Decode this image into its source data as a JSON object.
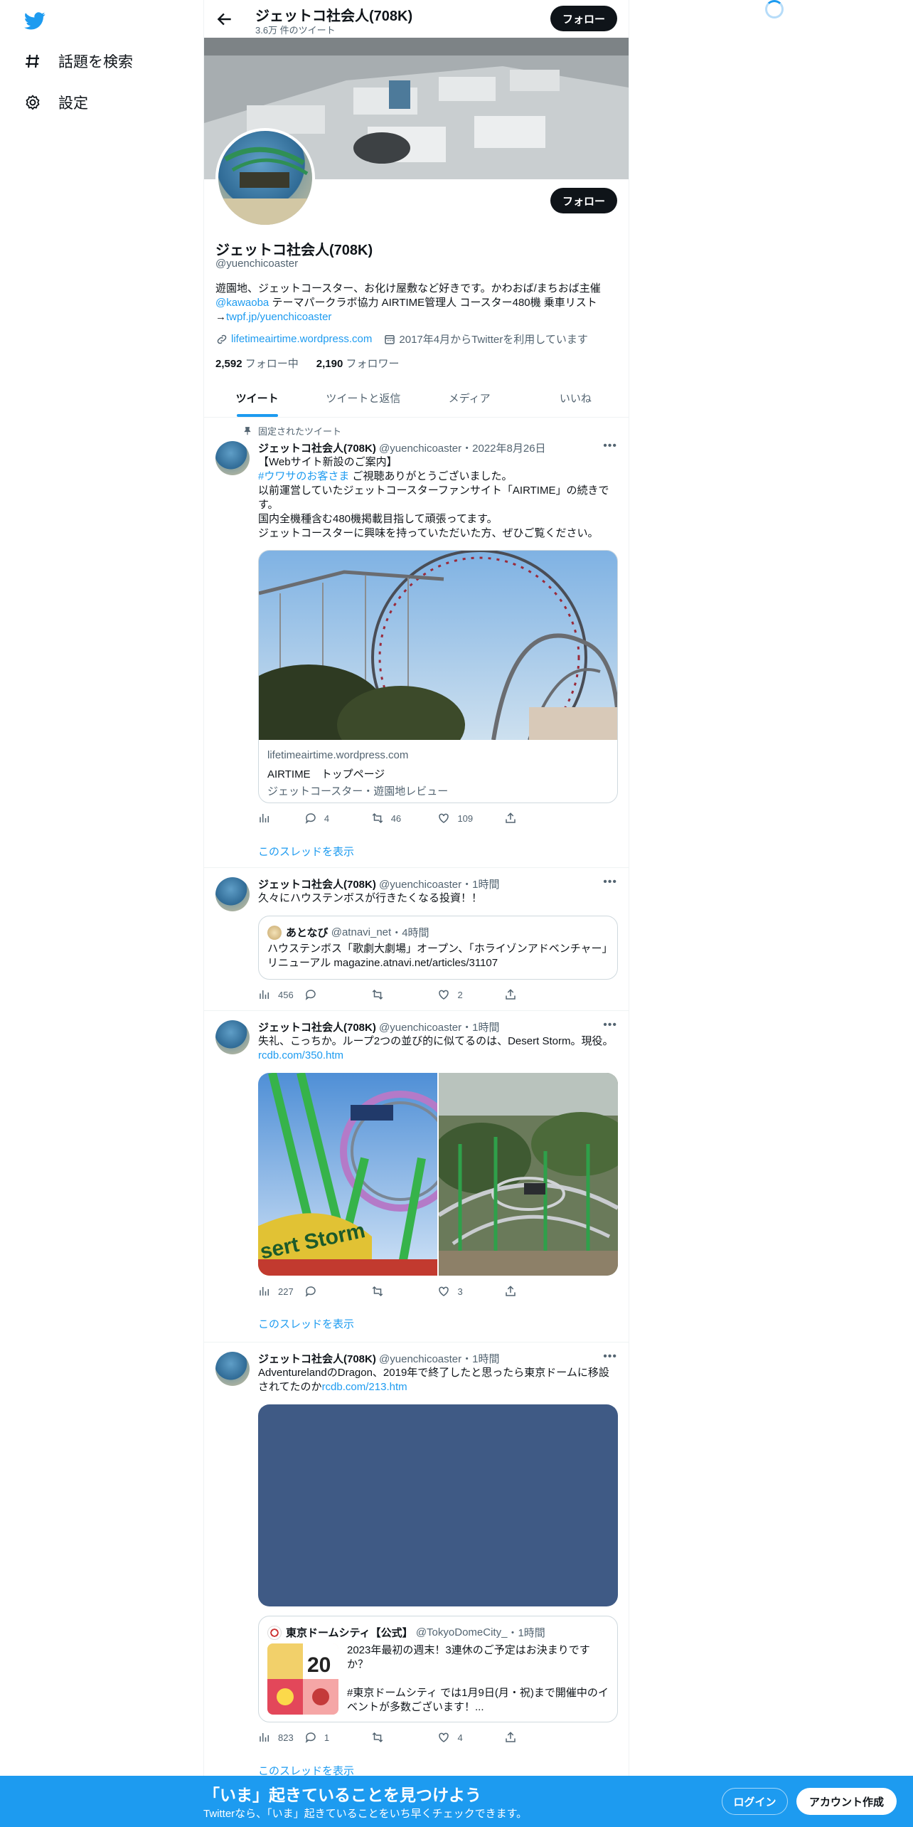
{
  "nav": {
    "explore_label": "話題を検索",
    "settings_label": "設定"
  },
  "header": {
    "name": "ジェットコ社会人(708K)",
    "tweet_count": "3.6万 件のツイート",
    "follow_label": "フォロー"
  },
  "profile": {
    "name": "ジェットコ社会人(708K)",
    "handle": "@yuenchicoaster",
    "follow_label": "フォロー",
    "bio_line1": "遊園地、ジェットコースター、お化け屋敷など好きです。かわおば/まちおば主催",
    "bio_mention": "@kawaoba",
    "bio_line2": " テーマパークラボ協力 AIRTIME管理人 コースター480機 乗車リスト",
    "bio_arrow": "→",
    "bio_link": "twpf.jp/yuenchicoaster",
    "website": "lifetimeairtime.wordpress.com",
    "joined": "2017年4月からTwitterを利用しています",
    "following_count": "2,592",
    "following_label": "フォロー中",
    "followers_count": "2,190",
    "followers_label": "フォロワー"
  },
  "tabs": [
    "ツイート",
    "ツイートと返信",
    "メディア",
    "いいね"
  ],
  "tweets": [
    {
      "pinned_label": "固定されたツイート",
      "name": "ジェットコ社会人(708K)",
      "handle": "@yuenchicoaster",
      "time": "・2022年8月26日",
      "line1": "【Webサイト新設のご案内】",
      "hashtag": "#ウワサのお客さま",
      "line2": " ご視聴ありがとうございました。",
      "line3": "以前運営していたジェットコースターファンサイト「AIRTIME」の続きです。",
      "line4": "国内全機種含む480機掲載目指して頑張ってます。",
      "line5": "ジェットコースターに興味を持っていただいた方、ぜひご覧ください。",
      "card_domain": "lifetimeairtime.wordpress.com",
      "card_title": "AIRTIME　トップページ",
      "card_desc": "ジェットコースター・遊園地レビュー",
      "replies": "4",
      "retweets": "46",
      "likes": "109",
      "thread_label": "このスレッドを表示"
    },
    {
      "name": "ジェットコ社会人(708K)",
      "handle": "@yuenchicoaster",
      "time": "・1時間",
      "text": "久々にハウステンボスが行きたくなる投資！！",
      "quote_name": "あとなび",
      "quote_handle": "@atnavi_net",
      "quote_time": "・4時間",
      "quote_text": "ハウステンボス「歌劇大劇場」オープン、「ホライゾンアドベンチャー」リニューアル magazine.atnavi.net/articles/31107",
      "views": "456",
      "likes": "2"
    },
    {
      "name": "ジェットコ社会人(708K)",
      "handle": "@yuenchicoaster",
      "time": "・1時間",
      "text": "失礼、こっちか。ループ2つの並び的に似てるのは、Desert Storm。現役。",
      "link": "rcdb.com/350.htm",
      "views": "227",
      "likes": "3",
      "thread_label": "このスレッドを表示"
    },
    {
      "name": "ジェットコ社会人(708K)",
      "handle": "@yuenchicoaster",
      "time": "・1時間",
      "text": "AdventurelandのDragon、2019年で終了したと思ったら東京ドームに移設されてたのか",
      "link": "rcdb.com/213.htm",
      "quote_name": "東京ドームシティ【公式】",
      "quote_handle": "@TokyoDomeCity_",
      "quote_time": "・1時間",
      "quote_line1": "2023年最初の週末！3連休のご予定はお決まりですか？",
      "quote_line2": "#東京ドームシティ では1月9日(月・祝)まで開催中のイベントが多数ございます！...",
      "views": "823",
      "replies": "1",
      "likes": "4",
      "thread_label": "このスレッドを表示"
    }
  ],
  "bottom": {
    "title": "「いま」起きていることを見つけよう",
    "subtitle": "Twitterなら、「いま」起きていることをいち早くチェックできます。",
    "login": "ログイン",
    "signup": "アカウント作成"
  },
  "colors": {
    "accent": "#1d9bf0",
    "text": "#0f1419",
    "muted": "#536471"
  }
}
